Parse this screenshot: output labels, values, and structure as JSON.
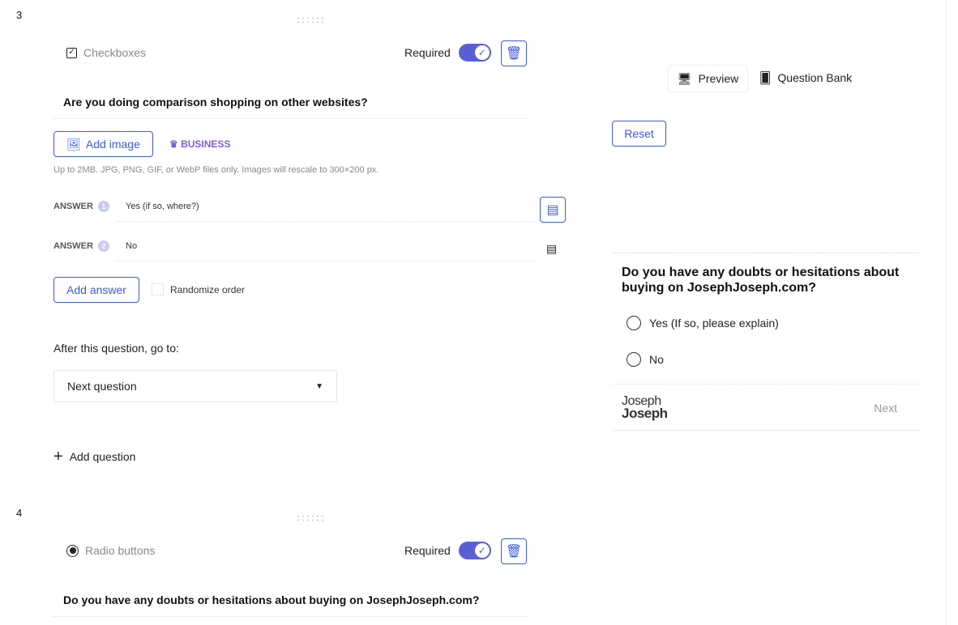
{
  "questions": [
    {
      "number": "3",
      "type": "Checkboxes",
      "required_label": "Required",
      "text": "Are you doing comparison shopping on other websites?",
      "add_image": "Add image",
      "business": "BUSINESS",
      "hint": "Up to 2MB. JPG, PNG, GIF, or WebP files only. Images will rescale to 300×200 px.",
      "answers": [
        {
          "label": "ANSWER",
          "n": "1",
          "value": "Yes (if so, where?)"
        },
        {
          "label": "ANSWER",
          "n": "2",
          "value": "No"
        }
      ],
      "add_answer": "Add answer",
      "randomize": "Randomize order",
      "goto_label": "After this question, go to:",
      "goto_value": "Next question"
    },
    {
      "number": "4",
      "type": "Radio buttons",
      "required_label": "Required",
      "text": "Do you have any doubts or hesitations about buying on JosephJoseph.com?"
    }
  ],
  "add_question": "Add question",
  "toolbar": {
    "preview": "Preview",
    "question_bank": "Question Bank",
    "reset": "Reset"
  },
  "preview": {
    "question": "Do you have any doubts or hesitations about buying on JosephJoseph.com?",
    "options": [
      "Yes (If so, please explain)",
      "No"
    ],
    "logo_line1": "Joseph",
    "logo_line2": "Joseph",
    "next": "Next"
  }
}
